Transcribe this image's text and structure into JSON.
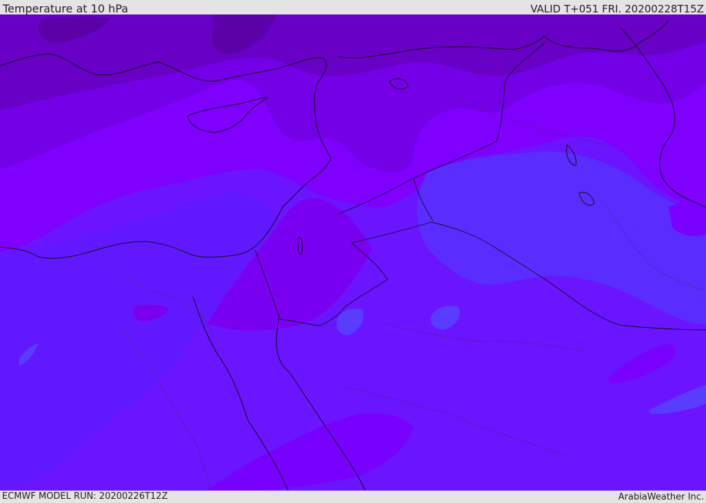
{
  "header": {
    "title": "Temperature at 10 hPa",
    "valid": "VALID T+051 FRI. 20200228T15Z"
  },
  "footer": {
    "model_run": "ECMWF MODEL RUN: 20200226T12Z",
    "credit": "ArabiaWeather Inc."
  },
  "map": {
    "colors": {
      "band_darkest": "#5c00a8",
      "band_dark": "#6a00c4",
      "band_mid": "#7800de",
      "band_bright": "#7f00ff",
      "band_violet": "#6a14ff",
      "band_blue": "#5a2cff",
      "coastline": "#111111"
    }
  }
}
